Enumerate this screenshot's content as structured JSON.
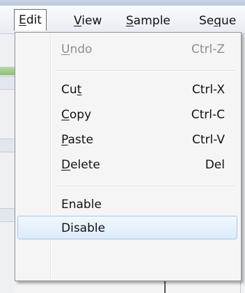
{
  "menubar": {
    "items": [
      {
        "label": "Edit",
        "mnemonic_index": 0
      },
      {
        "label": "View",
        "mnemonic_index": 0
      },
      {
        "label": "Sample",
        "mnemonic_index": 0
      },
      {
        "label": "Seque",
        "mnemonic_index": 2
      }
    ]
  },
  "edit_menu": {
    "items": [
      {
        "label": "Undo",
        "shortcut": "Ctrl-Z",
        "enabled": false
      },
      {
        "label": "Cut",
        "shortcut": "Ctrl-X",
        "enabled": true
      },
      {
        "label": "Copy",
        "shortcut": "Ctrl-C",
        "enabled": true
      },
      {
        "label": "Paste",
        "shortcut": "Ctrl-V",
        "enabled": true
      },
      {
        "label": "Delete",
        "shortcut": "Del",
        "enabled": true
      },
      {
        "label": "Enable",
        "shortcut": "",
        "enabled": true
      },
      {
        "label": "Disable",
        "shortcut": "",
        "enabled": true,
        "highlighted": true
      }
    ]
  },
  "colors": {
    "highlight_fill": "#dcebfb",
    "highlight_border": "#a7c6ec",
    "disabled_text": "#8d8d8d"
  }
}
